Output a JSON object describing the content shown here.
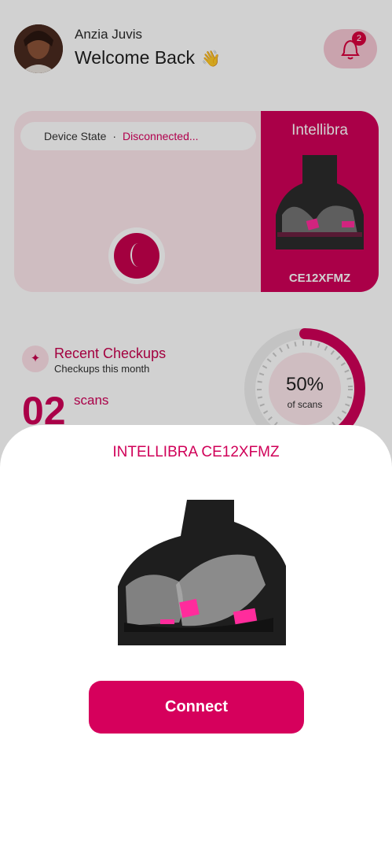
{
  "header": {
    "user_name": "Anzia Juvis",
    "welcome": "Welcome Back",
    "wave_emoji": "👋",
    "notification_count": "2",
    "icons": {
      "bell": "bell-icon",
      "avatar": "avatar"
    }
  },
  "device_card": {
    "state_label": "Device State",
    "separator": "·",
    "state_value": "Disconnected...",
    "brand": "Intellibra",
    "serial": "CE12XFMZ"
  },
  "checkups": {
    "title": "Recent Checkups",
    "subtitle": "Checkups this month",
    "count": "02",
    "unit": "scans",
    "percent": "50%",
    "percent_label": "of scans",
    "progress": 0.5
  },
  "sheet": {
    "title": "INTELLIBRA CE12XFMZ",
    "connect_label": "Connect"
  },
  "colors": {
    "accent": "#d6005c",
    "card_pink": "#fde7ec",
    "panel": "#d00058"
  }
}
